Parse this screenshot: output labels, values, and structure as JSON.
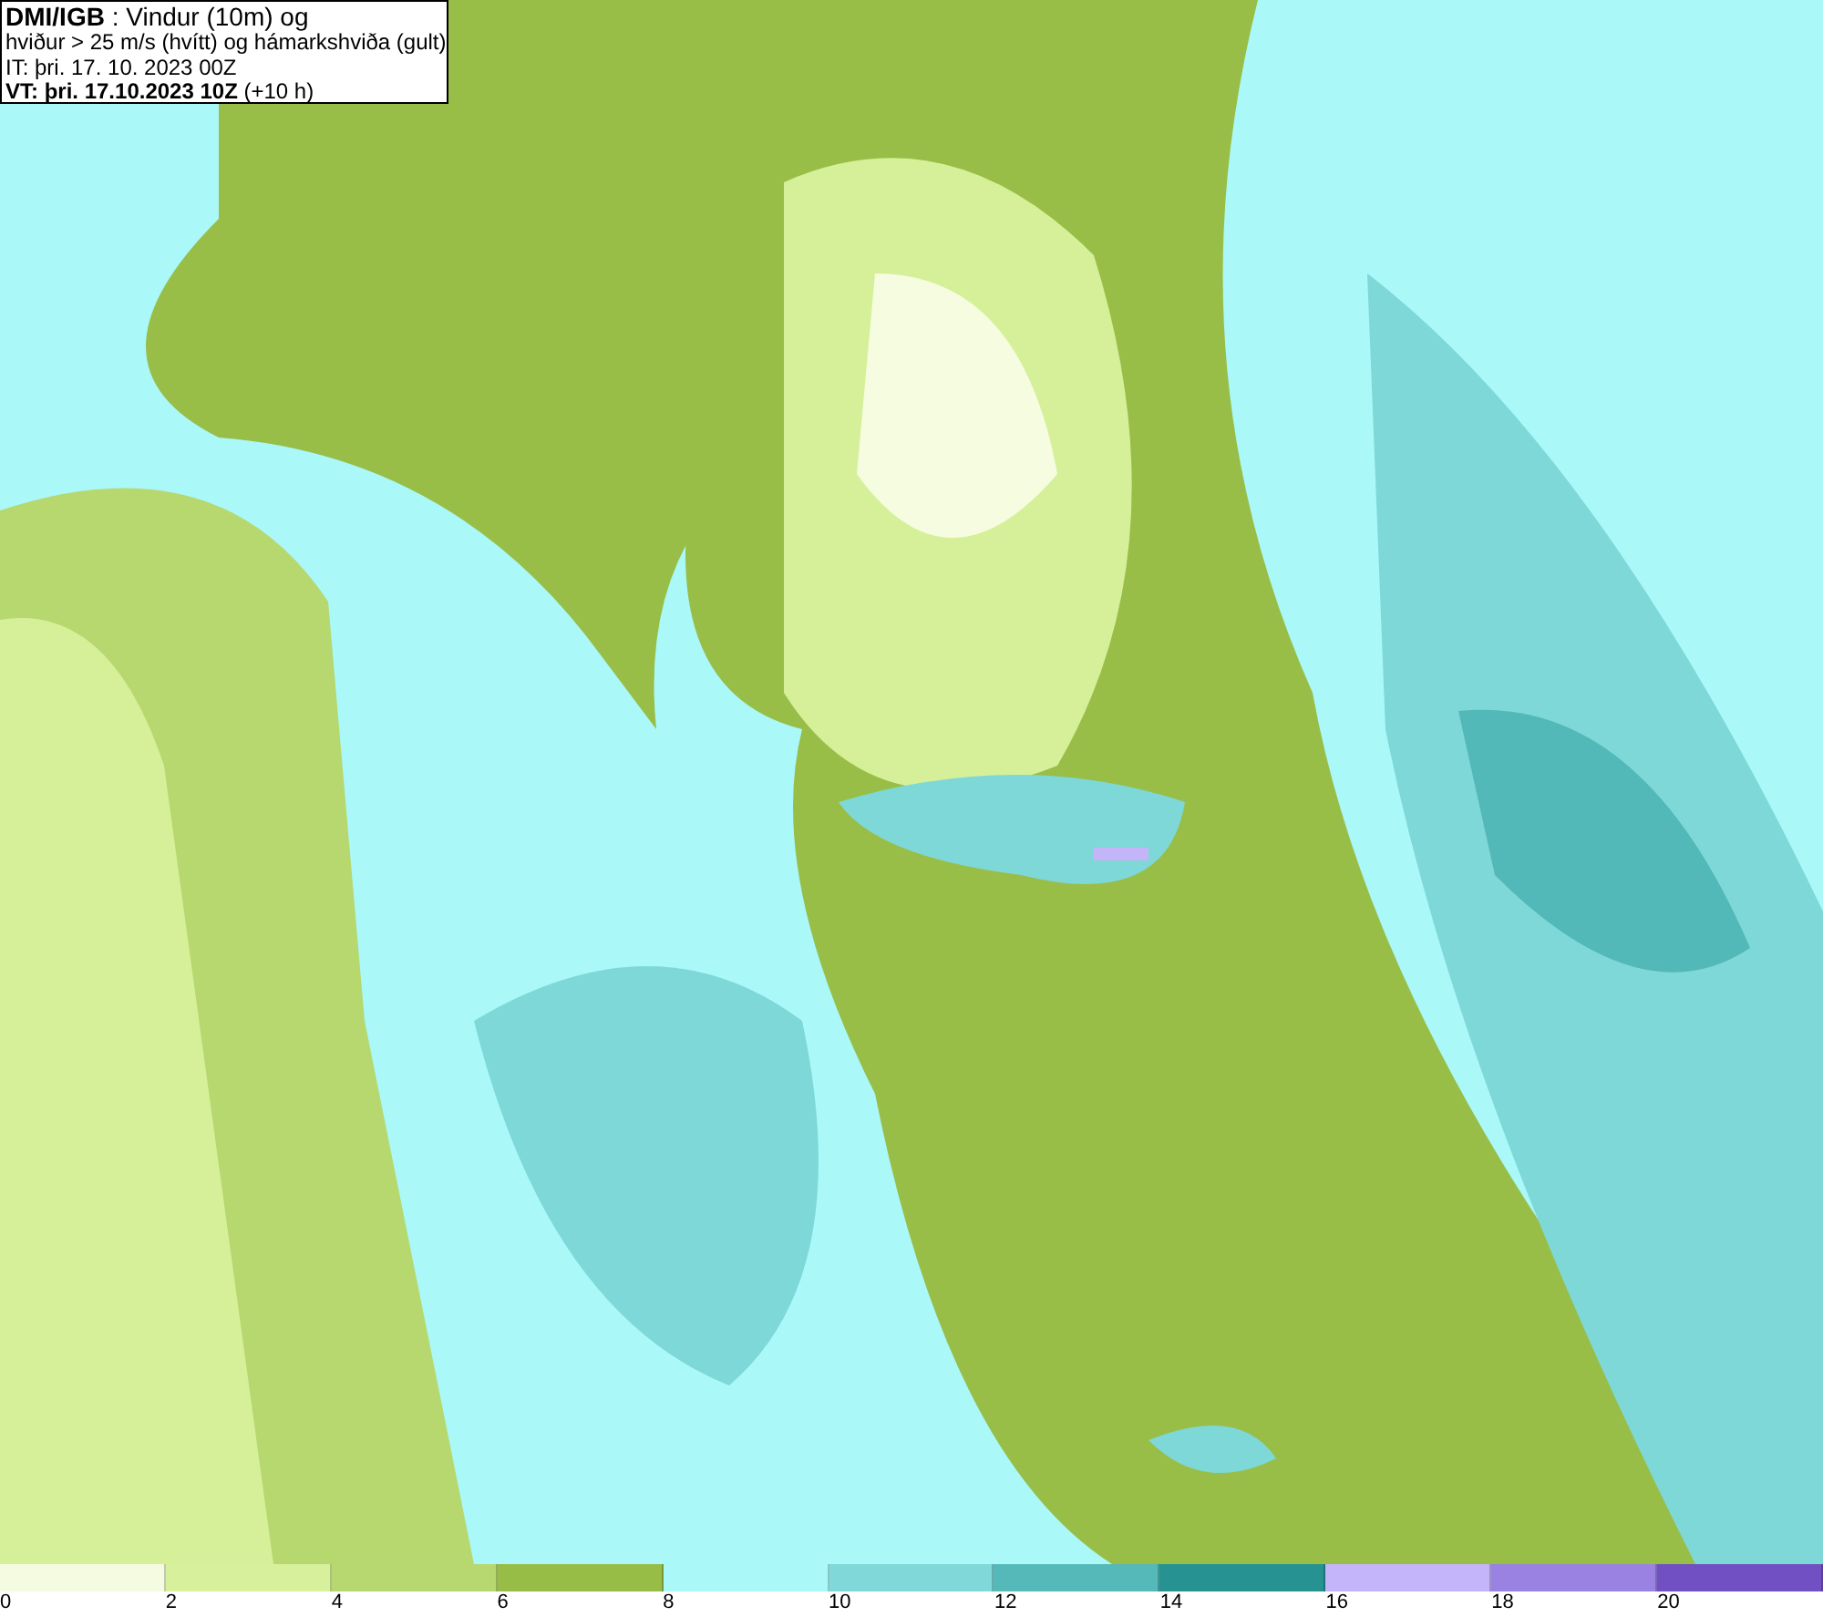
{
  "title_box": {
    "lines": [
      "**DMI/IGB** : Vindur (10m) og",
      "hviður > 25 m/s (hvítt) og hámarkshviða (gult)",
      "IT: þri. 17. 10. 2023 00Z",
      "**VT: þri. 17.10.2023 10Z** (+10 h)"
    ]
  },
  "legend": {
    "bins": [
      {
        "color": "#f4fbe0",
        "label": "0"
      },
      {
        "color": "#d7f09c",
        "label": "2"
      },
      {
        "color": "#b7d870",
        "label": "4"
      },
      {
        "color": "#98bd46",
        "label": "6"
      },
      {
        "color": "#aaf9f8",
        "label": "8"
      },
      {
        "color": "#80d8d8",
        "label": "10"
      },
      {
        "color": "#55b9b9",
        "label": "12"
      },
      {
        "color": "#269291",
        "label": "14"
      },
      {
        "color": "#c4b4fa",
        "label": "16"
      },
      {
        "color": "#9a82e2",
        "label": "18"
      },
      {
        "color": "#7050c2",
        "label": "20"
      }
    ]
  }
}
